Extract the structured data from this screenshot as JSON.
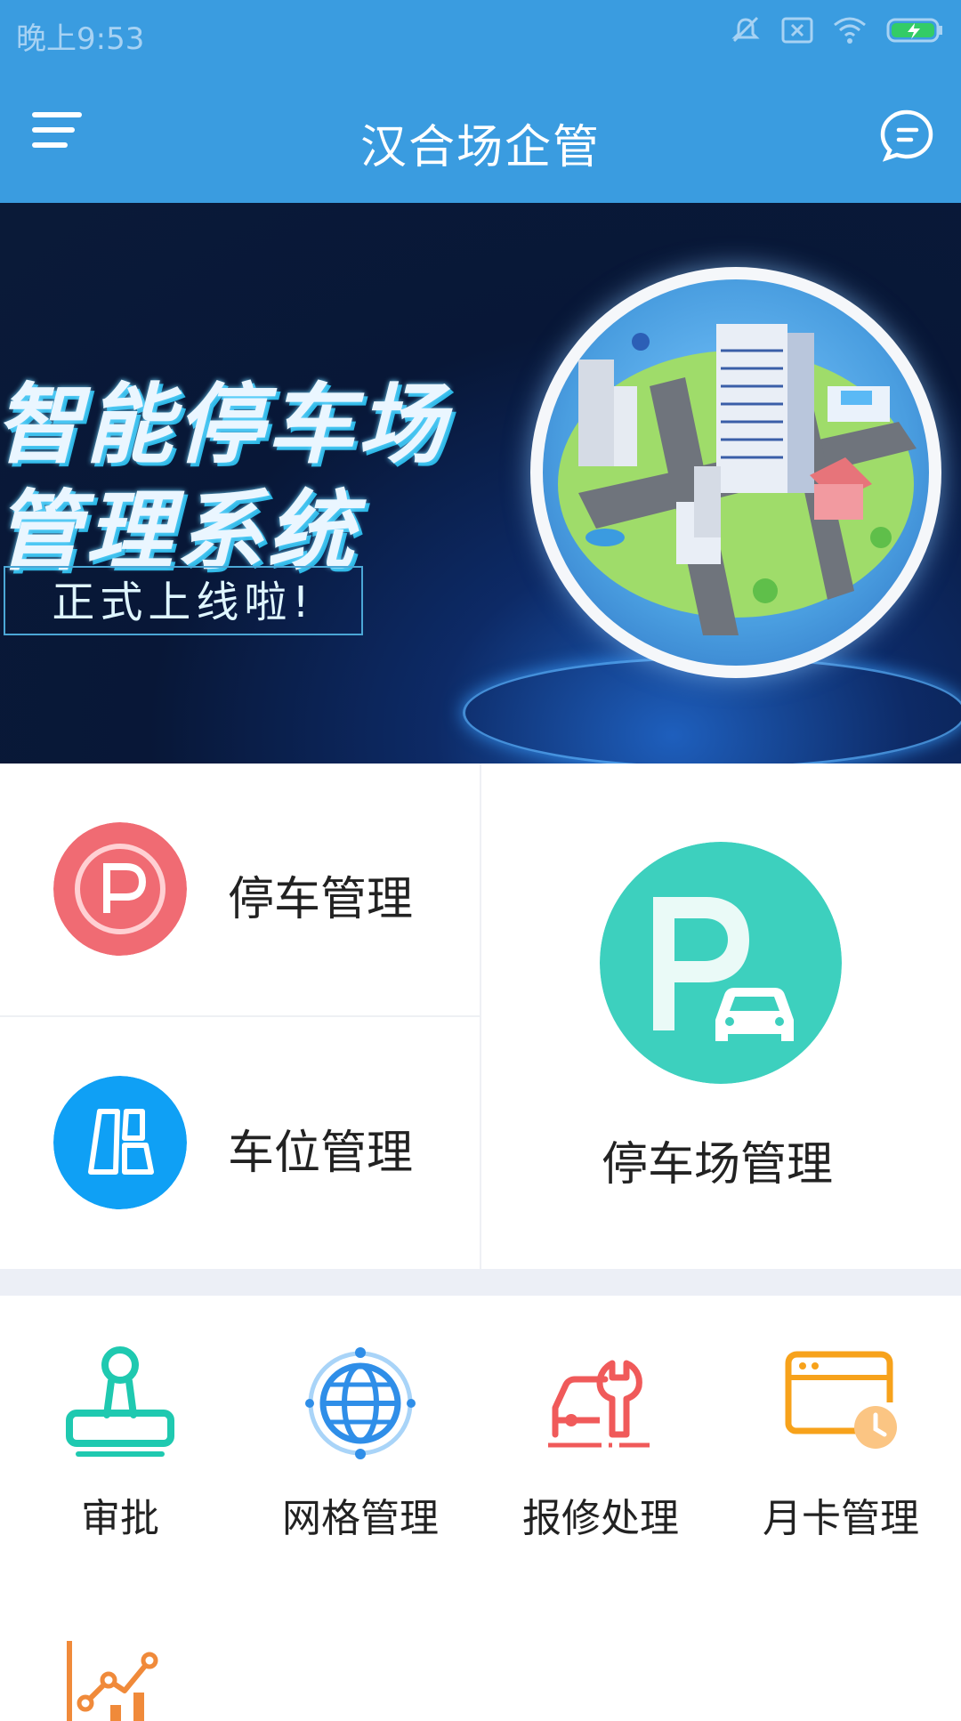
{
  "status_bar": {
    "time": "晚上9:53"
  },
  "app_bar": {
    "title": "汉合场企管"
  },
  "banner": {
    "headline_line1": "智能停车场",
    "headline_line2": "管理系统",
    "tag": "正式上线啦!"
  },
  "main_tiles": {
    "parking_mgmt": "停车管理",
    "space_mgmt": "车位管理",
    "lot_mgmt": "停车场管理"
  },
  "quick_actions": [
    {
      "label": "审批",
      "icon": "stamp-icon",
      "color": "#1fc9b0"
    },
    {
      "label": "网格管理",
      "icon": "globe-icon",
      "color": "#2f8ee8"
    },
    {
      "label": "报修处理",
      "icon": "car-wrench-icon",
      "color": "#f05a5a"
    },
    {
      "label": "月卡管理",
      "icon": "calendar-clock-icon",
      "color": "#f7a21b"
    }
  ],
  "colors": {
    "primary": "#3a9ce0",
    "parking_icon": "#f06b73",
    "space_icon": "#0fa0f5",
    "lot_icon": "#3dd0be",
    "stats_icon": "#f08a3a"
  }
}
